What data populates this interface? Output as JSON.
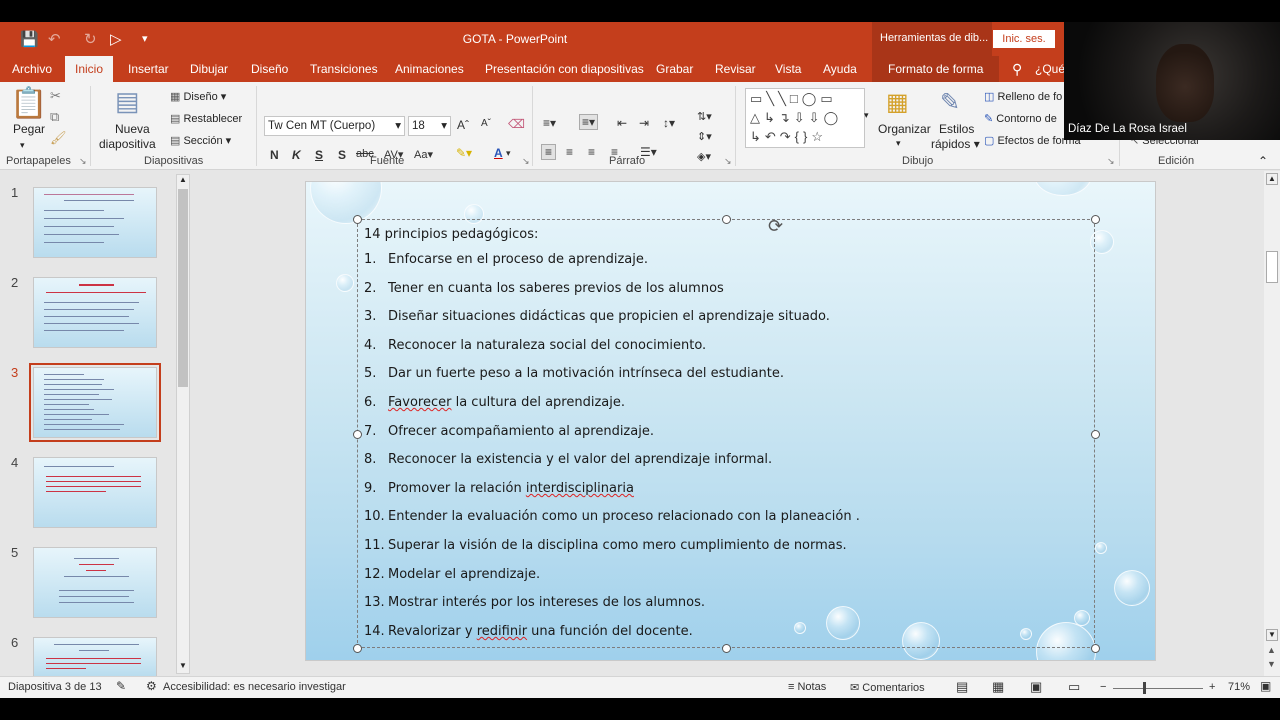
{
  "titlebar": {
    "doc_title": "GOTA  -  PowerPoint",
    "context_title": "Herramientas de dib...",
    "signin": "Inic. ses."
  },
  "tabs": [
    "Archivo",
    "Inicio",
    "Insertar",
    "Dibujar",
    "Diseño",
    "Transiciones",
    "Animaciones",
    "Presentación con diapositivas",
    "Grabar",
    "Revisar",
    "Vista",
    "Ayuda",
    "Formato de forma",
    "¿Qué"
  ],
  "ribbon": {
    "clipboard": {
      "paste": "Pegar",
      "label": "Portapapeles"
    },
    "slides": {
      "new_slide_1": "Nueva",
      "new_slide_2": "diapositiva",
      "layout": "Diseño",
      "reset": "Restablecer",
      "section": "Sección",
      "label": "Diapositivas"
    },
    "font": {
      "font_name": "Tw Cen MT (Cuerpo)",
      "font_size": "18",
      "label": "Fuente"
    },
    "paragraph": {
      "label": "Párrafo"
    },
    "drawing": {
      "arrange": "Organizar",
      "quick_styles_1": "Estilos",
      "quick_styles_2": "rápidos",
      "fill": "Relleno de fo",
      "outline": "Contorno de",
      "effects": "Efectos de forma",
      "label": "Dibujo"
    },
    "editing": {
      "select": "Seleccionar",
      "label": "Edición"
    }
  },
  "thumbnails": [
    {
      "num": "1"
    },
    {
      "num": "2"
    },
    {
      "num": "3"
    },
    {
      "num": "4"
    },
    {
      "num": "5"
    },
    {
      "num": "6"
    }
  ],
  "slide": {
    "heading": "14 principios pedagógicos:",
    "items": [
      {
        "n": "1.",
        "text": "Enfocarse en el proceso de aprendizaje."
      },
      {
        "n": "2.",
        "text": "Tener en cuanta los saberes previos de los alumnos"
      },
      {
        "n": "3.",
        "text": "Diseñar situaciones didácticas que propicien el aprendizaje situado."
      },
      {
        "n": "4.",
        "text": "Reconocer la naturaleza social del conocimiento."
      },
      {
        "n": "5.",
        "text": "Dar un fuerte peso a la motivación intrínseca del estudiante."
      },
      {
        "n": "6.",
        "text": "Favorecer la cultura del aprendizaje."
      },
      {
        "n": "7.",
        "text": "Ofrecer acompañamiento al aprendizaje."
      },
      {
        "n": "8.",
        "text": "Reconocer la existencia y el valor del aprendizaje informal."
      },
      {
        "n": "9.",
        "text": "Promover la relación interdisciplinaria"
      },
      {
        "n": "10.",
        "text": "Entender la evaluación como un proceso relacionado con la planeación ."
      },
      {
        "n": "11.",
        "text": "Superar la visión de la disciplina como mero cumplimiento de normas."
      },
      {
        "n": "12.",
        "text": "Modelar el aprendizaje."
      },
      {
        "n": "13.",
        "text": "Mostrar interés por los intereses de los alumnos."
      },
      {
        "n": "14.",
        "text": "Revalorizar y redifinir una función del docente."
      }
    ]
  },
  "status": {
    "slide_info": "Diapositiva 3 de 13",
    "accessibility": "Accesibilidad: es necesario investigar",
    "notes": "Notas",
    "comments": "Comentarios",
    "zoom": "71%"
  },
  "webcam": {
    "name": "Díaz De La Rosa Israel"
  },
  "colors": {
    "accent": "#c43e1c",
    "ribbon": "#f3f3f3",
    "slide_bg": "#cfe8f3"
  }
}
